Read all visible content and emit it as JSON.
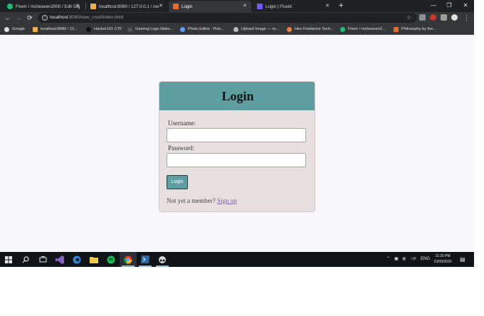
{
  "browser": {
    "tabs": [
      {
        "title": "Fiverr / mcheaven2000 / Edit Gig",
        "favicon_color": "#1dbf73",
        "active": false
      },
      {
        "title": "localhost:8080 / 127.0.0.1 / new_",
        "favicon_color": "#f0b050",
        "active": false
      },
      {
        "title": "Login",
        "favicon_color": "#e86a2c",
        "active": true
      },
      {
        "title": "Login | Fluvid",
        "favicon_color": "#6a5cff",
        "active": false
      }
    ],
    "close_glyph": "✕",
    "new_tab_glyph": "+",
    "window_controls": {
      "minimize": "—",
      "restore": "❐",
      "close": "✕"
    },
    "nav": {
      "back": "←",
      "forward": "→",
      "reload": "⟳"
    },
    "address": {
      "host": "localhost",
      "path": ":8080/new_crud/index.html"
    },
    "bookmarks": [
      {
        "label": "Google",
        "icon_color": "#e0e0e0"
      },
      {
        "label": "localhost:8080 / 12...",
        "icon_color": "#f0b050"
      },
      {
        "label": "Hacker101 CTF",
        "icon_color": "#111111"
      },
      {
        "label": "Gaming Logo Make...",
        "icon_color": "#555555"
      },
      {
        "label": "Photo Editor : Pixlr...",
        "icon_color": "#5aa0ff"
      },
      {
        "label": "Upload Image — re...",
        "icon_color": "#bbbbbb"
      },
      {
        "label": "Hire Freelance Tech...",
        "icon_color": "#f08040"
      },
      {
        "label": "Fiverr / mcheaven2...",
        "icon_color": "#1dbf73"
      },
      {
        "label": "Philosophy by the...",
        "icon_color": "#e86a2c"
      }
    ]
  },
  "login": {
    "title": "Login",
    "username_label": "Username:",
    "username_value": "",
    "password_label": "Password:",
    "password_value": "",
    "button_label": "Login",
    "signup_prompt": "Not yet a member?",
    "signup_link": "Sign up"
  },
  "colors": {
    "header": "#5f9ea0",
    "card": "#e8dfdf",
    "link": "#7b5ea7"
  },
  "taskbar": {
    "language": "ENG",
    "time": "11:20 PM",
    "date": "23/09/2020"
  }
}
